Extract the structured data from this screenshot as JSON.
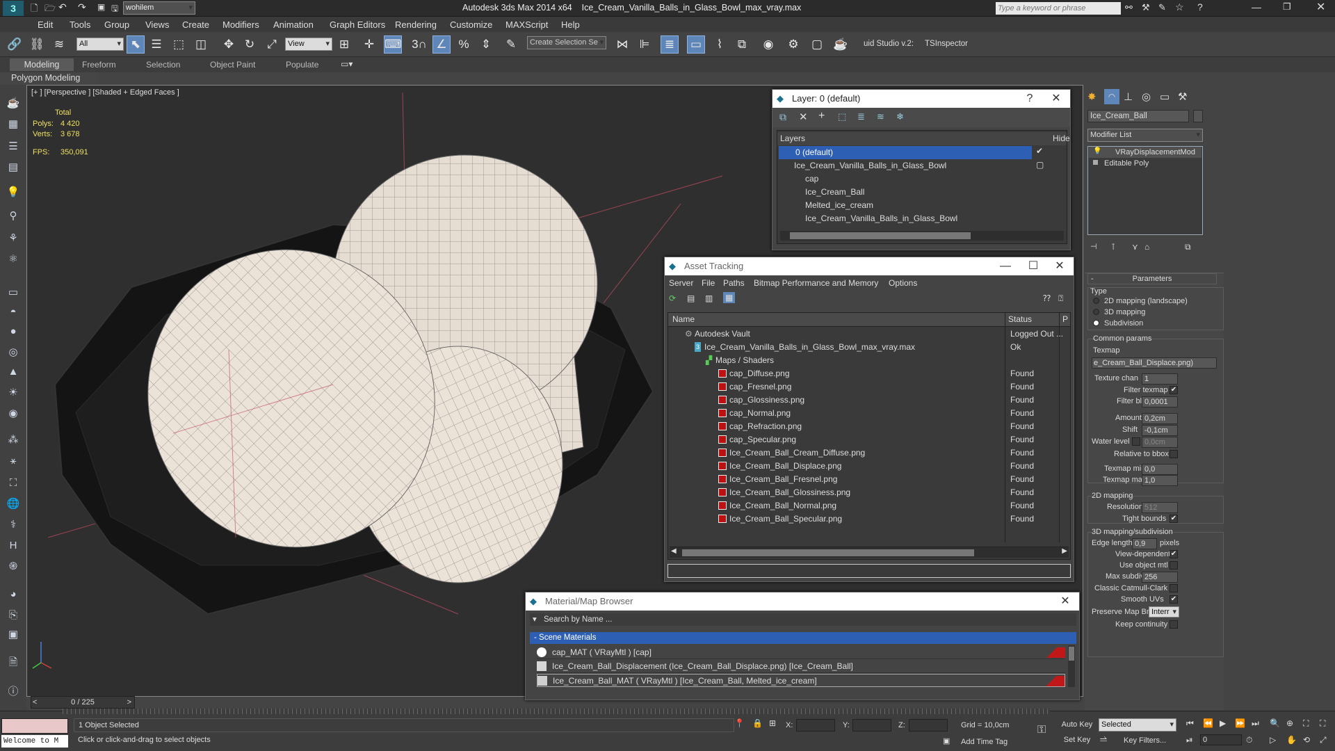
{
  "title": {
    "workspace": "wohilem",
    "app": "Autodesk 3ds Max  2014 x64",
    "file": "Ice_Cream_Vanilla_Balls_in_Glass_Bowl_max_vray.max",
    "search_placeholder": "Type a keyword or phrase"
  },
  "menu": [
    "Edit",
    "Tools",
    "Group",
    "Views",
    "Create",
    "Modifiers",
    "Animation",
    "Graph Editors",
    "Rendering",
    "Customize",
    "MAXScript",
    "Help"
  ],
  "toolbar": {
    "filter": "All",
    "refcoord": "View",
    "selset": "Create Selection Se",
    "studio": "uid Studio v.2:",
    "inspector": "TSInspector",
    "snap3": "3"
  },
  "ribbon": {
    "tabs": [
      "Modeling",
      "Freeform",
      "Selection",
      "Object Paint",
      "Populate"
    ],
    "sub": "Polygon Modeling"
  },
  "viewport": {
    "label": "[+ ] [Perspective ] [Shaded + Edged Faces ]",
    "stats": {
      "total": "Total",
      "polys_label": "Polys:",
      "polys": "4 420",
      "verts_label": "Verts:",
      "verts": "3 678",
      "fps_label": "FPS:",
      "fps": "350,091"
    }
  },
  "layer": {
    "title": "Layer: 0 (default)",
    "col_layers": "Layers",
    "col_hide": "Hide",
    "items": [
      "0 (default)",
      "Ice_Cream_Vanilla_Balls_in_Glass_Bowl",
      "cap",
      "Ice_Cream_Ball",
      "Melted_ice_cream",
      "Ice_Cream_Vanilla_Balls_in_Glass_Bowl"
    ],
    "help": "?"
  },
  "asset": {
    "title": "Asset Tracking",
    "menu": [
      "Server",
      "File",
      "Paths",
      "Bitmap Performance and Memory",
      "Options"
    ],
    "col_name": "Name",
    "col_status": "Status",
    "col_p": "P",
    "rows": [
      {
        "name": "Autodesk Vault",
        "status": "Logged Out ..."
      },
      {
        "name": "Ice_Cream_Vanilla_Balls_in_Glass_Bowl_max_vray.max",
        "status": "Ok"
      },
      {
        "name": "Maps / Shaders",
        "status": ""
      },
      {
        "name": "cap_Diffuse.png",
        "status": "Found"
      },
      {
        "name": "cap_Fresnel.png",
        "status": "Found"
      },
      {
        "name": "cap_Glossiness.png",
        "status": "Found"
      },
      {
        "name": "cap_Normal.png",
        "status": "Found"
      },
      {
        "name": "cap_Refraction.png",
        "status": "Found"
      },
      {
        "name": "cap_Specular.png",
        "status": "Found"
      },
      {
        "name": "Ice_Cream_Ball_Cream_Diffuse.png",
        "status": "Found"
      },
      {
        "name": "Ice_Cream_Ball_Displace.png",
        "status": "Found"
      },
      {
        "name": "Ice_Cream_Ball_Fresnel.png",
        "status": "Found"
      },
      {
        "name": "Ice_Cream_Ball_Glossiness.png",
        "status": "Found"
      },
      {
        "name": "Ice_Cream_Ball_Normal.png",
        "status": "Found"
      },
      {
        "name": "Ice_Cream_Ball_Specular.png",
        "status": "Found"
      }
    ]
  },
  "matbrowser": {
    "title": "Material/Map Browser",
    "search": "Search by Name ...",
    "section": "- Scene Materials",
    "items": [
      "cap_MAT  ( VRayMtl )  [cap]",
      "Ice_Cream_Ball_Displacement (Ice_Cream_Ball_Displace.png) [Ice_Cream_Ball]",
      "Ice_Cream_Ball_MAT  ( VRayMtl )  [Ice_Cream_Ball, Melted_ice_cream]"
    ]
  },
  "cmd": {
    "object": "Ice_Cream_Ball",
    "modlist": "Modifier List",
    "stack": [
      "VRayDisplacementMod",
      "Editable Poly"
    ],
    "params": "Parameters",
    "type": "Type",
    "type_opts": [
      "2D mapping (landscape)",
      "3D mapping",
      "Subdivision"
    ],
    "common": "Common params",
    "texmap": "Texmap",
    "texmap_val": "e_Cream_Ball_Displace.png)",
    "texture_chan": "Texture chan",
    "texture_chan_val": "1",
    "filter_texmap": "Filter texmap",
    "filter_blur": "Filter blur",
    "filter_blur_val": "0,0001",
    "amount": "Amount",
    "amount_val": "0,2cm",
    "shift": "Shift",
    "shift_val": "-0,1cm",
    "water": "Water level",
    "water_val": "0,0cm",
    "relbbox": "Relative to bbox",
    "tmin": "Texmap min",
    "tmin_val": "0,0",
    "tmax": "Texmap max",
    "tmax_val": "1,0",
    "map2d": "2D mapping",
    "resolution": "Resolution",
    "resolution_val": "512",
    "tight": "Tight bounds",
    "map3d": "3D mapping/subdivision",
    "edge": "Edge length",
    "edge_val": "0,9",
    "pixels": "pixels",
    "viewdep": "View-dependent",
    "useobj": "Use object mtl",
    "maxsub": "Max subdivs",
    "maxsub_val": "256",
    "catmull": "Classic Catmull-Clark",
    "smoothuv": "Smooth UVs",
    "pmb": "Preserve Map Bnd",
    "pmb_val": "Interr",
    "keepcont": "Keep continuity"
  },
  "status": {
    "selected": "1 Object Selected",
    "prompt": "Click or click-and-drag to select objects",
    "welcome": "Welcome to M",
    "frame": "0 / 225",
    "x": "X:",
    "y": "Y:",
    "z": "Z:",
    "grid": "Grid = 10,0cm",
    "addtag": "Add Time Tag",
    "autokey": "Auto Key",
    "setkey": "Set Key",
    "selected_dd": "Selected",
    "keyfilters": "Key Filters...",
    "frame_num": "0"
  }
}
